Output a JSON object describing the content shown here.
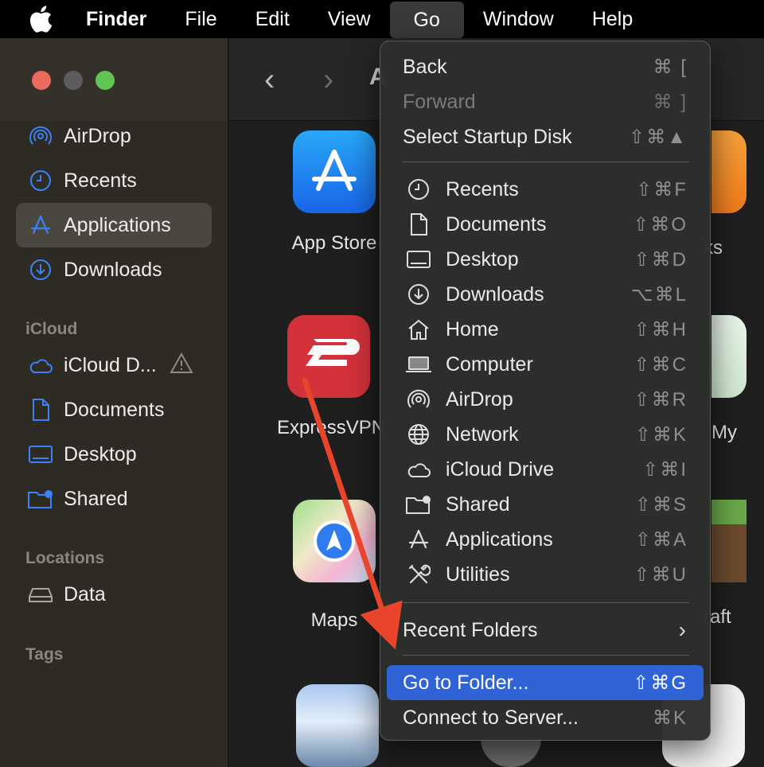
{
  "menubar": {
    "app_name": "Finder",
    "items": [
      "File",
      "Edit",
      "View",
      "Go",
      "Window",
      "Help"
    ]
  },
  "sidebar": {
    "favorites": [
      "AirDrop",
      "Recents",
      "Applications",
      "Downloads"
    ],
    "icloud_header": "iCloud",
    "icloud": [
      "iCloud D...",
      "Documents",
      "Desktop",
      "Shared"
    ],
    "locations_header": "Locations",
    "locations": [
      "Data"
    ],
    "tags_header": "Tags"
  },
  "content": {
    "apps": [
      "App Store",
      "ExpressVPN",
      "Maps"
    ],
    "partial_labels": [
      "ks",
      "My",
      "raft"
    ],
    "title_partial": "A"
  },
  "go_menu": {
    "back": {
      "label": "Back",
      "shortcut": "⌘ ["
    },
    "forward": {
      "label": "Forward",
      "shortcut": "⌘ ]"
    },
    "startup": {
      "label": "Select Startup Disk",
      "shortcut": "⇧⌘▲"
    },
    "places": [
      {
        "label": "Recents",
        "shortcut": "⇧⌘F"
      },
      {
        "label": "Documents",
        "shortcut": "⇧⌘O"
      },
      {
        "label": "Desktop",
        "shortcut": "⇧⌘D"
      },
      {
        "label": "Downloads",
        "shortcut": "⌥⌘L"
      },
      {
        "label": "Home",
        "shortcut": "⇧⌘H"
      },
      {
        "label": "Computer",
        "shortcut": "⇧⌘C"
      },
      {
        "label": "AirDrop",
        "shortcut": "⇧⌘R"
      },
      {
        "label": "Network",
        "shortcut": "⇧⌘K"
      },
      {
        "label": "iCloud Drive",
        "shortcut": "⇧⌘I"
      },
      {
        "label": "Shared",
        "shortcut": "⇧⌘S"
      },
      {
        "label": "Applications",
        "shortcut": "⇧⌘A"
      },
      {
        "label": "Utilities",
        "shortcut": "⇧⌘U"
      }
    ],
    "recent_folders": "Recent Folders",
    "go_to_folder": {
      "label": "Go to Folder...",
      "shortcut": "⇧⌘G"
    },
    "connect": {
      "label": "Connect to Server...",
      "shortcut": "⌘K"
    }
  },
  "colors": {
    "highlight": "#2f63d6",
    "annotation_arrow": "#e8452c",
    "traffic_red": "#ec6a5e",
    "traffic_gray": "#5c5c5c",
    "traffic_green": "#61c554",
    "sidebar_icon": "#3b82f6"
  }
}
